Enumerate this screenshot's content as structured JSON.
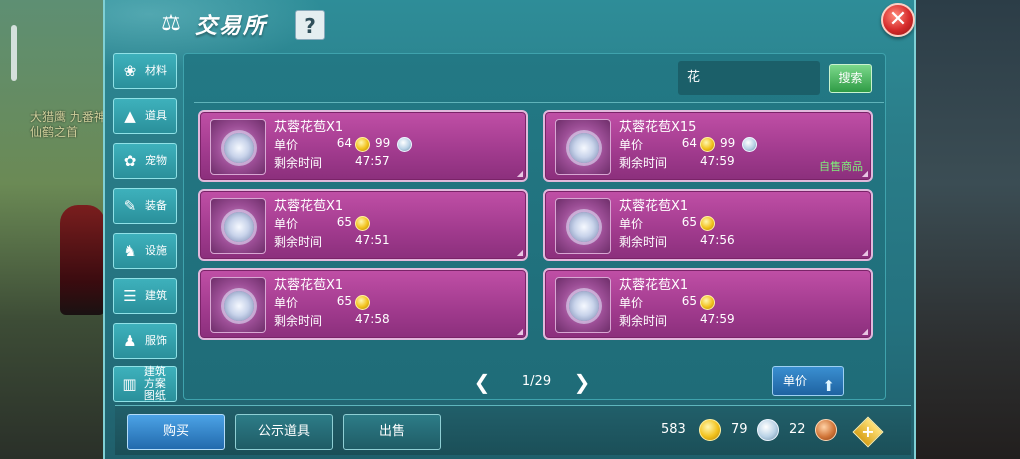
{
  "header": {
    "title": "交易所",
    "help_label": "?",
    "close_label": "✕"
  },
  "background": {
    "npc_text": "大猎鹰 九番神 仙鹤之首"
  },
  "sidebar": {
    "items": [
      {
        "label": "材料",
        "icon": "materials-icon",
        "glyph": "❀"
      },
      {
        "label": "道具",
        "icon": "potion-icon",
        "glyph": "▲"
      },
      {
        "label": "宠物",
        "icon": "paw-icon",
        "glyph": "✿"
      },
      {
        "label": "装备",
        "icon": "equipment-icon",
        "glyph": "✎"
      },
      {
        "label": "设施",
        "icon": "facility-icon",
        "glyph": "♞"
      },
      {
        "label": "建筑",
        "icon": "building-icon",
        "glyph": "☰"
      },
      {
        "label": "服饰",
        "icon": "clothing-icon",
        "glyph": "♟"
      },
      {
        "label": "建筑方案图纸",
        "icon": "blueprint-icon",
        "glyph": "▥"
      }
    ]
  },
  "search": {
    "value": "花",
    "button_label": "搜索"
  },
  "listings": [
    {
      "name": "苁蓉花苞X1",
      "price_label": "单价",
      "gold": "64",
      "silver": "99",
      "time_label": "剩余时间",
      "time": "47:57",
      "self": ""
    },
    {
      "name": "苁蓉花苞X15",
      "price_label": "单价",
      "gold": "64",
      "silver": "99",
      "time_label": "剩余时间",
      "time": "47:59",
      "self": "自售商品"
    },
    {
      "name": "苁蓉花苞X1",
      "price_label": "单价",
      "gold": "65",
      "silver": "",
      "time_label": "剩余时间",
      "time": "47:51",
      "self": ""
    },
    {
      "name": "苁蓉花苞X1",
      "price_label": "单价",
      "gold": "65",
      "silver": "",
      "time_label": "剩余时间",
      "time": "47:56",
      "self": ""
    },
    {
      "name": "苁蓉花苞X1",
      "price_label": "单价",
      "gold": "65",
      "silver": "",
      "time_label": "剩余时间",
      "time": "47:58",
      "self": ""
    },
    {
      "name": "苁蓉花苞X1",
      "price_label": "单价",
      "gold": "65",
      "silver": "",
      "time_label": "剩余时间",
      "time": "47:59",
      "self": ""
    }
  ],
  "pager": {
    "text": "1/29",
    "prev": "❮",
    "next": "❯"
  },
  "sort": {
    "label": "单价",
    "arrow": "⬆"
  },
  "actions": {
    "buy": "购买",
    "public": "公示道具",
    "sell": "出售"
  },
  "currency": {
    "gold": "583",
    "silver": "79",
    "bronze": "22",
    "plus": "+"
  },
  "colors": {
    "panel": "#2a7d89",
    "card": "#a03a8d",
    "self_tag": "#7ff07a",
    "buy": "#226aad"
  }
}
